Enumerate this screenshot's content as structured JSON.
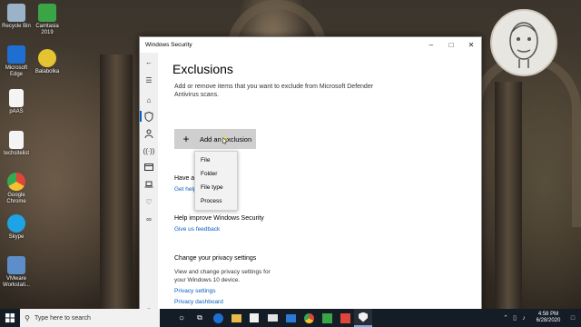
{
  "desktop": {
    "icons": [
      {
        "name": "recycle-bin",
        "label": "Recycle Bin",
        "color": "#9ab3c9"
      },
      {
        "name": "camtasia",
        "label": "Camtasia 2019",
        "color": "#3aa546"
      },
      {
        "name": "microsoft-edge",
        "label": "Microsoft Edge",
        "color": "#1e6fd1"
      },
      {
        "name": "balabolka",
        "label": "Balabolka",
        "color": "#e5c432"
      },
      {
        "name": "paas",
        "label": "pAAS",
        "color": "#f4f4f4"
      },
      {
        "name": "techsitelist",
        "label": "techsitelist",
        "color": "#f4f4f4"
      },
      {
        "name": "google-chrome",
        "label": "Google Chrome",
        "color": "#e0453a"
      },
      {
        "name": "skype",
        "label": "Skype",
        "color": "#1ea3e6"
      },
      {
        "name": "vmware",
        "label": "VMware Workstati...",
        "color": "#5d8ec9"
      }
    ]
  },
  "window": {
    "title": "Windows Security",
    "page_title": "Exclusions",
    "description": "Add or remove items that you want to exclude from Microsoft Defender Antivirus scans.",
    "add_button": "Add an exclusion",
    "menu": [
      "File",
      "Folder",
      "File type",
      "Process"
    ],
    "have_question": "Have a",
    "get_help": "Get help",
    "help_improve_title": "Help improve Windows Security",
    "give_feedback": "Give us feedback",
    "privacy_title": "Change your privacy settings",
    "privacy_text": "View and change privacy settings for your Windows 10 device.",
    "privacy_settings": "Privacy settings",
    "privacy_dashboard": "Privacy dashboard"
  },
  "taskbar": {
    "search_placeholder": "Type here to search",
    "time": "4:58 PM",
    "date": "6/28/2020"
  },
  "colors": {
    "accent": "#0b5fbf",
    "taskbar": "#141c26"
  }
}
